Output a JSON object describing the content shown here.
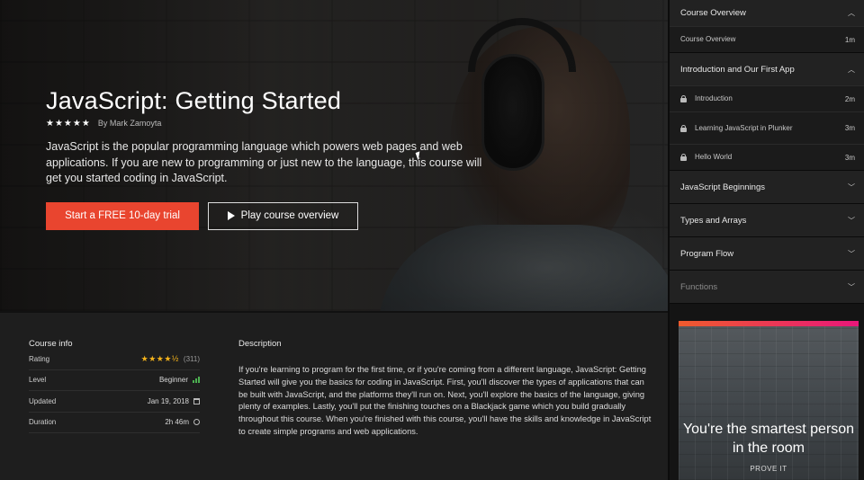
{
  "hero": {
    "title": "JavaScript: Getting Started",
    "rating_stars": "★★★★★",
    "author": "By Mark Zamoyta",
    "blurb": "JavaScript is the popular programming language which powers web pages and web applications. If you are new to programming or just new to the language, this course will get you started coding in JavaScript.",
    "trial_button": "Start a FREE 10-day trial",
    "overview_button": "Play course overview"
  },
  "sidebar": {
    "modules": [
      {
        "title": "Course Overview",
        "expanded": true,
        "clips": [
          {
            "title": "Course Overview",
            "duration": "1m",
            "locked": false
          }
        ]
      },
      {
        "title": "Introduction and Our First App",
        "expanded": true,
        "clips": [
          {
            "title": "Introduction",
            "duration": "2m",
            "locked": true
          },
          {
            "title": "Learning JavaScript in Plunker",
            "duration": "3m",
            "locked": true
          },
          {
            "title": "Hello World",
            "duration": "3m",
            "locked": true
          }
        ]
      },
      {
        "title": "JavaScript Beginnings",
        "expanded": false
      },
      {
        "title": "Types and Arrays",
        "expanded": false
      },
      {
        "title": "Program Flow",
        "expanded": false
      },
      {
        "title": "Functions",
        "expanded": false
      }
    ],
    "ad": {
      "headline": "You're the smartest person in the room",
      "cta": "PROVE IT"
    }
  },
  "course_info": {
    "heading": "Course info",
    "rating_label": "Rating",
    "rating_stars": "★★★★½",
    "rating_count": "(311)",
    "level_label": "Level",
    "level_value": "Beginner",
    "updated_label": "Updated",
    "updated_value": "Jan 19, 2018",
    "duration_label": "Duration",
    "duration_value": "2h 46m"
  },
  "description": {
    "heading": "Description",
    "text": "If you're learning to program for the first time, or if you're coming from a different language, JavaScript: Getting Started will give you the basics for coding in JavaScript. First, you'll discover the types of applications that can be built with JavaScript, and the platforms they'll run on. Next, you'll explore the basics of the language, giving plenty of examples. Lastly, you'll put the finishing touches on a Blackjack game which you build gradually throughout this course. When you're finished with this course, you'll have the skills and knowledge in JavaScript to create simple programs and web applications."
  },
  "colors": {
    "accent": "#e9452f",
    "star": "#f3b21b",
    "level": "#4caf50"
  }
}
